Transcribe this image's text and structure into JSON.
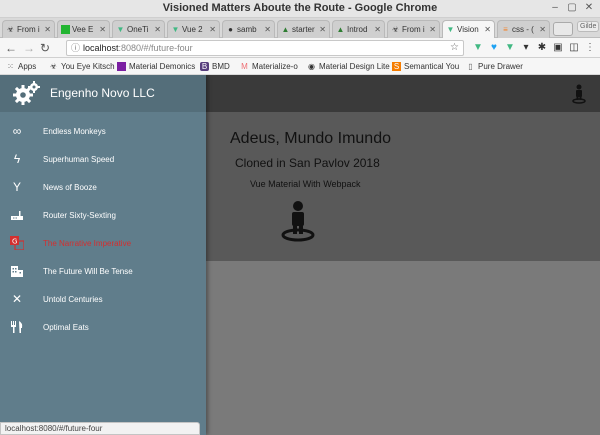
{
  "window": {
    "title": "Visioned Matters Aboute the Route - Google Chrome"
  },
  "tabs": [
    {
      "label": "From i",
      "icon": "biohazard-icon",
      "active": false
    },
    {
      "label": "Vee E",
      "icon": "green-square-icon",
      "active": false
    },
    {
      "label": "OneTi",
      "icon": "vue-icon",
      "active": false
    },
    {
      "label": "Vue 2",
      "icon": "vue-icon",
      "active": false
    },
    {
      "label": "samb",
      "icon": "github-icon",
      "active": false
    },
    {
      "label": "starter",
      "icon": "mountain-icon",
      "active": false
    },
    {
      "label": "Introd",
      "icon": "mountain-icon",
      "active": false
    },
    {
      "label": "From i",
      "icon": "biohazard-icon",
      "active": false
    },
    {
      "label": "Vision",
      "icon": "vue-icon",
      "active": true
    },
    {
      "label": "css - (",
      "icon": "stack-icon",
      "active": false
    }
  ],
  "profile_label": "Gilde",
  "address": {
    "host": "localhost",
    "path": ":8080/#/future-four"
  },
  "bookmarks": [
    {
      "label": "Apps",
      "icon": "apps-grid-icon"
    },
    {
      "label": "You Eye Kitsch",
      "icon": "biohazard-icon"
    },
    {
      "label": "Material Demonics",
      "icon": "purple-square-icon"
    },
    {
      "label": "BMD",
      "icon": "bootstrap-icon"
    },
    {
      "label": "Materialize-o",
      "icon": "materialize-icon"
    },
    {
      "label": "Material Design Lite",
      "icon": "mdl-icon"
    },
    {
      "label": "Semantical You",
      "icon": "semantic-icon"
    },
    {
      "label": "Pure Drawer",
      "icon": "page-icon"
    }
  ],
  "app": {
    "brand": "Engenho Novo LLC",
    "heading": "Adeus, Mundo Imundo",
    "subheading": "Cloned in San Pavlov 2018",
    "caption": "Vue Material With Webpack"
  },
  "menu": [
    {
      "label": "Endless Monkeys",
      "icon": "infinity-icon",
      "active": false
    },
    {
      "label": "Superhuman Speed",
      "icon": "flash-icon",
      "active": false
    },
    {
      "label": "News of Booze",
      "icon": "cocktail-icon",
      "active": false
    },
    {
      "label": "Router Sixty-Sexting",
      "icon": "router-icon",
      "active": false
    },
    {
      "label": "The Narrative Imperative",
      "icon": "translate-icon",
      "active": true
    },
    {
      "label": "The Future Will Be Tense",
      "icon": "city-icon",
      "active": false
    },
    {
      "label": "Untold Centuries",
      "icon": "utensils-cross-icon",
      "active": false
    },
    {
      "label": "Optimal Eats",
      "icon": "restaurant-icon",
      "active": false
    }
  ],
  "status_url": "localhost:8080/#/future-four",
  "colors": {
    "drawer": "#607d8b",
    "drawer_header": "#546e7a",
    "active_item": "#d32f2f",
    "appbar": "#3a3a3a",
    "content": "#595959"
  }
}
